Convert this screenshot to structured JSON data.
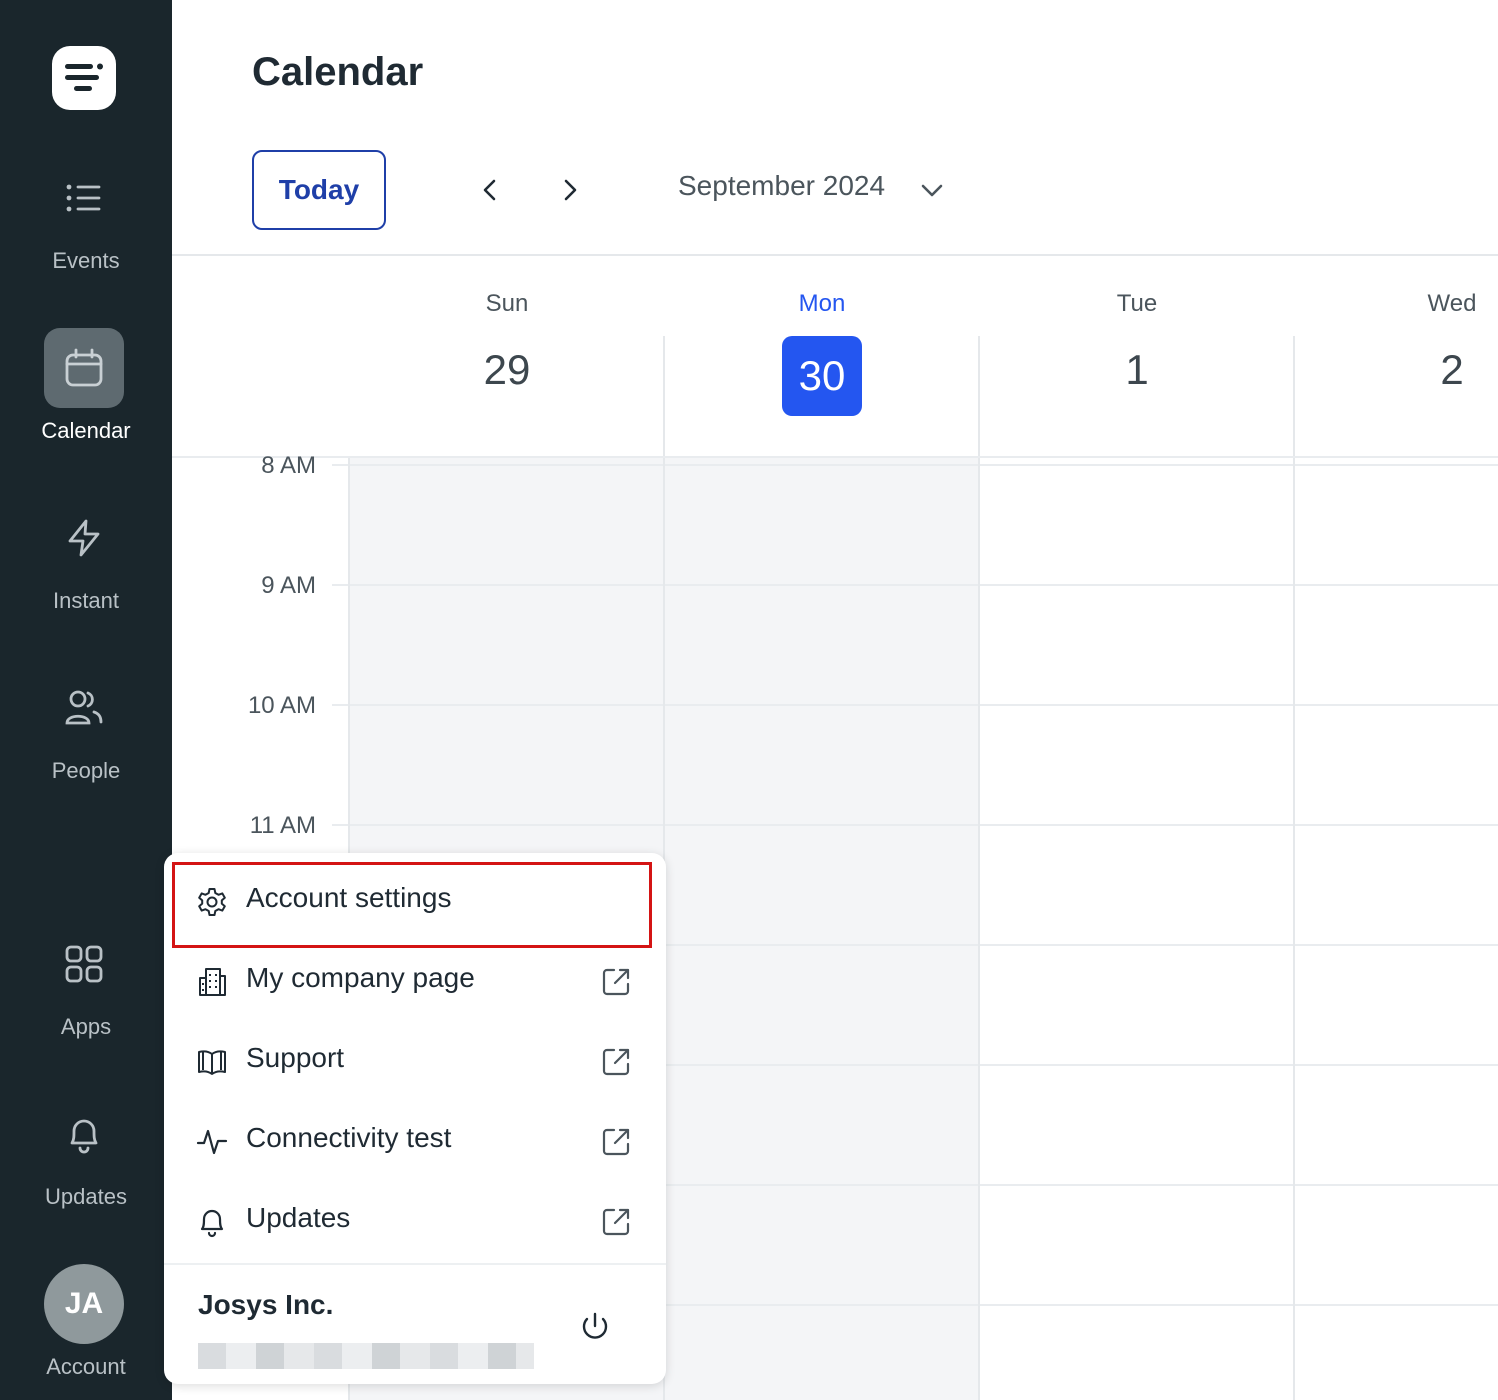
{
  "sidebar": {
    "items": [
      {
        "label": "Events",
        "icon": "list-icon"
      },
      {
        "label": "Calendar",
        "icon": "calendar-icon",
        "active": true
      },
      {
        "label": "Instant",
        "icon": "lightning-icon"
      },
      {
        "label": "People",
        "icon": "people-icon"
      },
      {
        "label": "Apps",
        "icon": "apps-grid-icon"
      },
      {
        "label": "Updates",
        "icon": "bell-icon"
      }
    ],
    "account": {
      "initials": "JA",
      "label": "Account"
    }
  },
  "header": {
    "title": "Calendar",
    "today_label": "Today",
    "month_label": "September 2024"
  },
  "days": [
    {
      "name": "Sun",
      "num": "29"
    },
    {
      "name": "Mon",
      "num": "30",
      "today": true
    },
    {
      "name": "Tue",
      "num": "1"
    },
    {
      "name": "Wed",
      "num": "2"
    }
  ],
  "times": [
    "8 AM",
    "9 AM",
    "10 AM",
    "11 AM"
  ],
  "menu": {
    "items": [
      {
        "label": "Account settings",
        "icon": "gear-icon",
        "external": false,
        "highlighted": true
      },
      {
        "label": "My company page",
        "icon": "building-icon",
        "external": true
      },
      {
        "label": "Support",
        "icon": "book-icon",
        "external": true
      },
      {
        "label": "Connectivity test",
        "icon": "activity-icon",
        "external": true
      },
      {
        "label": "Updates",
        "icon": "bell-icon",
        "external": true
      }
    ],
    "org_name": "Josys Inc."
  },
  "colors": {
    "sidebar_bg": "#1a262c",
    "accent": "#2456f0",
    "today_button": "#1f3fa8",
    "highlight_border": "#d41414"
  }
}
